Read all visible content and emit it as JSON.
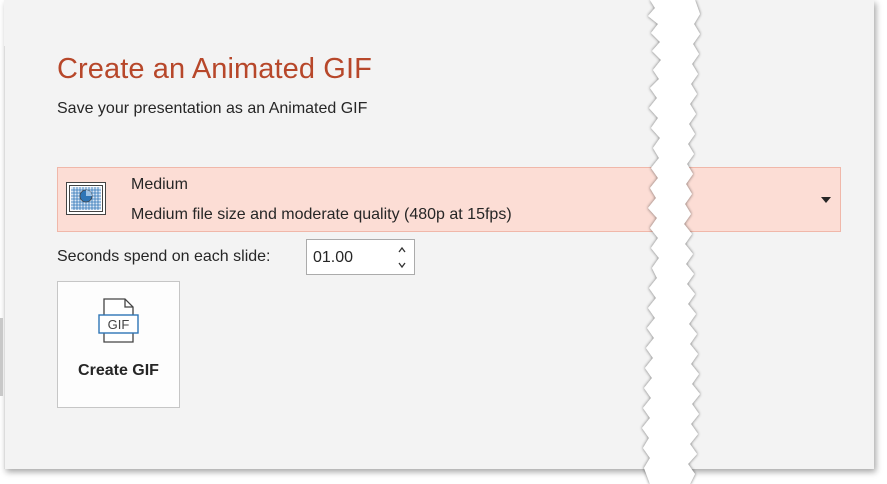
{
  "header": {
    "title": "Create an Animated GIF",
    "subtitle": "Save your presentation as an Animated GIF"
  },
  "quality": {
    "icon": "presentation-quality-icon",
    "selected_name": "Medium",
    "selected_description": "Medium file size and moderate quality (480p at 15fps)",
    "dropdown_icon": "chevron-down-icon",
    "highlight_color": "#fcddd5"
  },
  "seconds": {
    "label": "Seconds spend on each slide:",
    "value": "01.00",
    "up_icon": "chevron-up-icon",
    "down_icon": "chevron-down-icon"
  },
  "create_button": {
    "icon": "gif-file-icon",
    "label": "Create GIF",
    "icon_text": "GIF"
  },
  "colors": {
    "title": "#b7472a",
    "background": "#f3f3f3",
    "accent_blue": "#2e75b6"
  }
}
